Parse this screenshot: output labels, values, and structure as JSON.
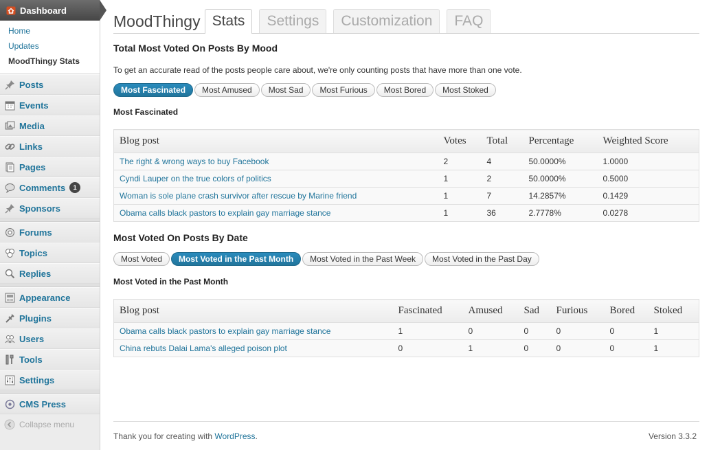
{
  "sidebar": {
    "dashboard": "Dashboard",
    "sub": [
      "Home",
      "Updates",
      "MoodThingy Stats"
    ],
    "menu1": [
      {
        "label": "Posts",
        "icon": "pin-icon"
      },
      {
        "label": "Events",
        "icon": "calendar-icon"
      },
      {
        "label": "Media",
        "icon": "media-icon"
      },
      {
        "label": "Links",
        "icon": "link-icon"
      },
      {
        "label": "Pages",
        "icon": "pages-icon"
      },
      {
        "label": "Comments",
        "icon": "comment-icon",
        "badge": "1"
      },
      {
        "label": "Sponsors",
        "icon": "pin-icon"
      }
    ],
    "menu2": [
      {
        "label": "Forums",
        "icon": "forum-icon"
      },
      {
        "label": "Topics",
        "icon": "topics-icon"
      },
      {
        "label": "Replies",
        "icon": "replies-icon"
      }
    ],
    "menu3": [
      {
        "label": "Appearance",
        "icon": "appearance-icon"
      },
      {
        "label": "Plugins",
        "icon": "plugin-icon"
      },
      {
        "label": "Users",
        "icon": "users-icon"
      },
      {
        "label": "Tools",
        "icon": "tools-icon"
      },
      {
        "label": "Settings",
        "icon": "settings-icon"
      }
    ],
    "cms": "CMS Press",
    "collapse": "Collapse menu"
  },
  "header": {
    "title": "MoodThingy",
    "tabs": [
      "Stats",
      "Settings",
      "Customization",
      "FAQ"
    ],
    "active_tab": "Stats"
  },
  "mood_section": {
    "title": "Total Most Voted On Posts By Mood",
    "note": "To get an accurate read of the posts people care about, we're only counting posts that have more than one vote.",
    "filters": [
      "Most Fascinated",
      "Most Amused",
      "Most Sad",
      "Most Furious",
      "Most Bored",
      "Most Stoked"
    ],
    "active_filter": "Most Fascinated",
    "subheading": "Most Fascinated",
    "columns": [
      "Blog post",
      "Votes",
      "Total",
      "Percentage",
      "Weighted Score"
    ],
    "rows": [
      [
        "The right & wrong ways to buy Facebook",
        "2",
        "4",
        "50.0000%",
        "1.0000"
      ],
      [
        "Cyndi Lauper on the true colors of politics",
        "1",
        "2",
        "50.0000%",
        "0.5000"
      ],
      [
        "Woman is sole plane crash survivor after rescue by Marine friend",
        "1",
        "7",
        "14.2857%",
        "0.1429"
      ],
      [
        "Obama calls black pastors to explain gay marriage stance",
        "1",
        "36",
        "2.7778%",
        "0.0278"
      ]
    ]
  },
  "date_section": {
    "title": "Most Voted On Posts By Date",
    "filters": [
      "Most Voted",
      "Most Voted in the Past Month",
      "Most Voted in the Past Week",
      "Most Voted in the Past Day"
    ],
    "active_filter": "Most Voted in the Past Month",
    "subheading": "Most Voted in the Past Month",
    "columns": [
      "Blog post",
      "Fascinated",
      "Amused",
      "Sad",
      "Furious",
      "Bored",
      "Stoked"
    ],
    "rows": [
      [
        "Obama calls black pastors to explain gay marriage stance",
        "1",
        "0",
        "0",
        "0",
        "0",
        "1"
      ],
      [
        "China rebuts Dalai Lama's alleged poison plot",
        "0",
        "1",
        "0",
        "0",
        "0",
        "1"
      ]
    ]
  },
  "footer": {
    "thanks_prefix": "Thank you for creating with ",
    "thanks_link": "WordPress",
    "thanks_suffix": ".",
    "version": "Version 3.3.2"
  },
  "colors": {
    "link": "#21759b",
    "active_pill": "#21759b",
    "sidebar_bg": "#ececec",
    "header_dark": "#464646"
  }
}
